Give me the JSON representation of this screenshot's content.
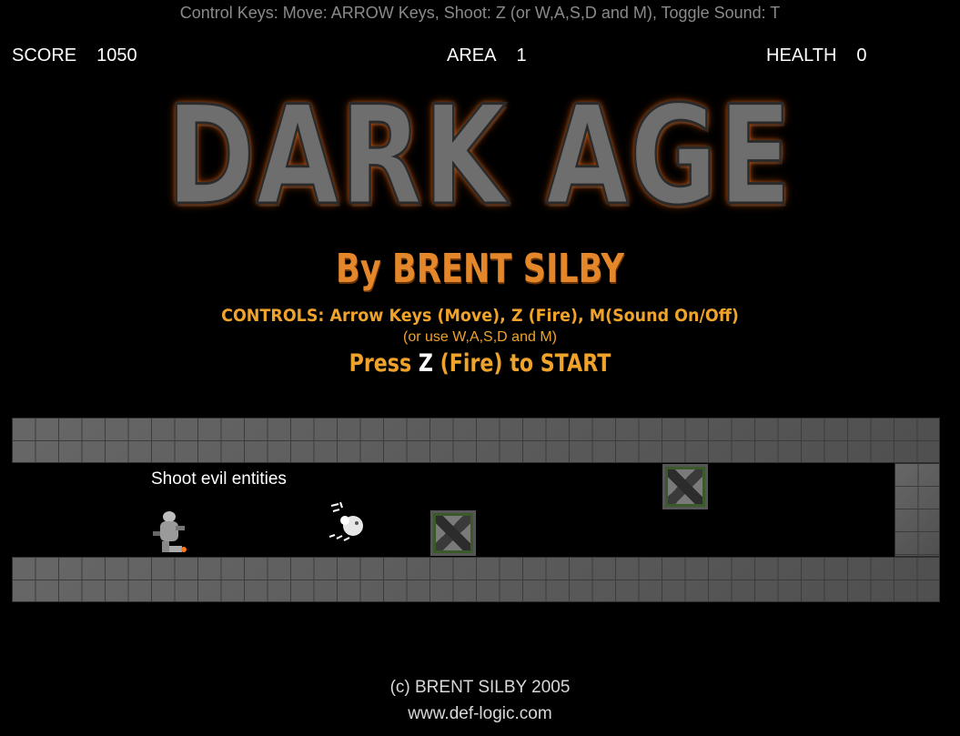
{
  "header": {
    "controls_hint": "Control Keys: Move: ARROW Keys, Shoot: Z (or W,A,S,D and M), Toggle Sound: T"
  },
  "hud": {
    "score_label": "SCORE",
    "score_value": "1050",
    "area_label": "AREA",
    "area_value": "1",
    "health_label": "HEALTH",
    "health_value": "0"
  },
  "title_screen": {
    "logo": "DARK AGE",
    "byline": "By BRENT SILBY",
    "controls_line": "CONTROLS: Arrow Keys (Move), Z (Fire), M(Sound On/Off)",
    "alt_controls_line": "(or use W,A,S,D and M)",
    "press_prefix": "Press ",
    "press_key": "Z",
    "press_suffix": " (Fire) to START"
  },
  "level": {
    "tutorial_text": "Shoot evil entities"
  },
  "footer": {
    "copyright": "(c) BRENT SILBY 2005",
    "url": "www.def-logic.com"
  },
  "colors": {
    "background": "#000000",
    "hint_text": "#8a8a8a",
    "accent_orange": "#f0a32a",
    "stone_gray": "#5a5a5a"
  }
}
